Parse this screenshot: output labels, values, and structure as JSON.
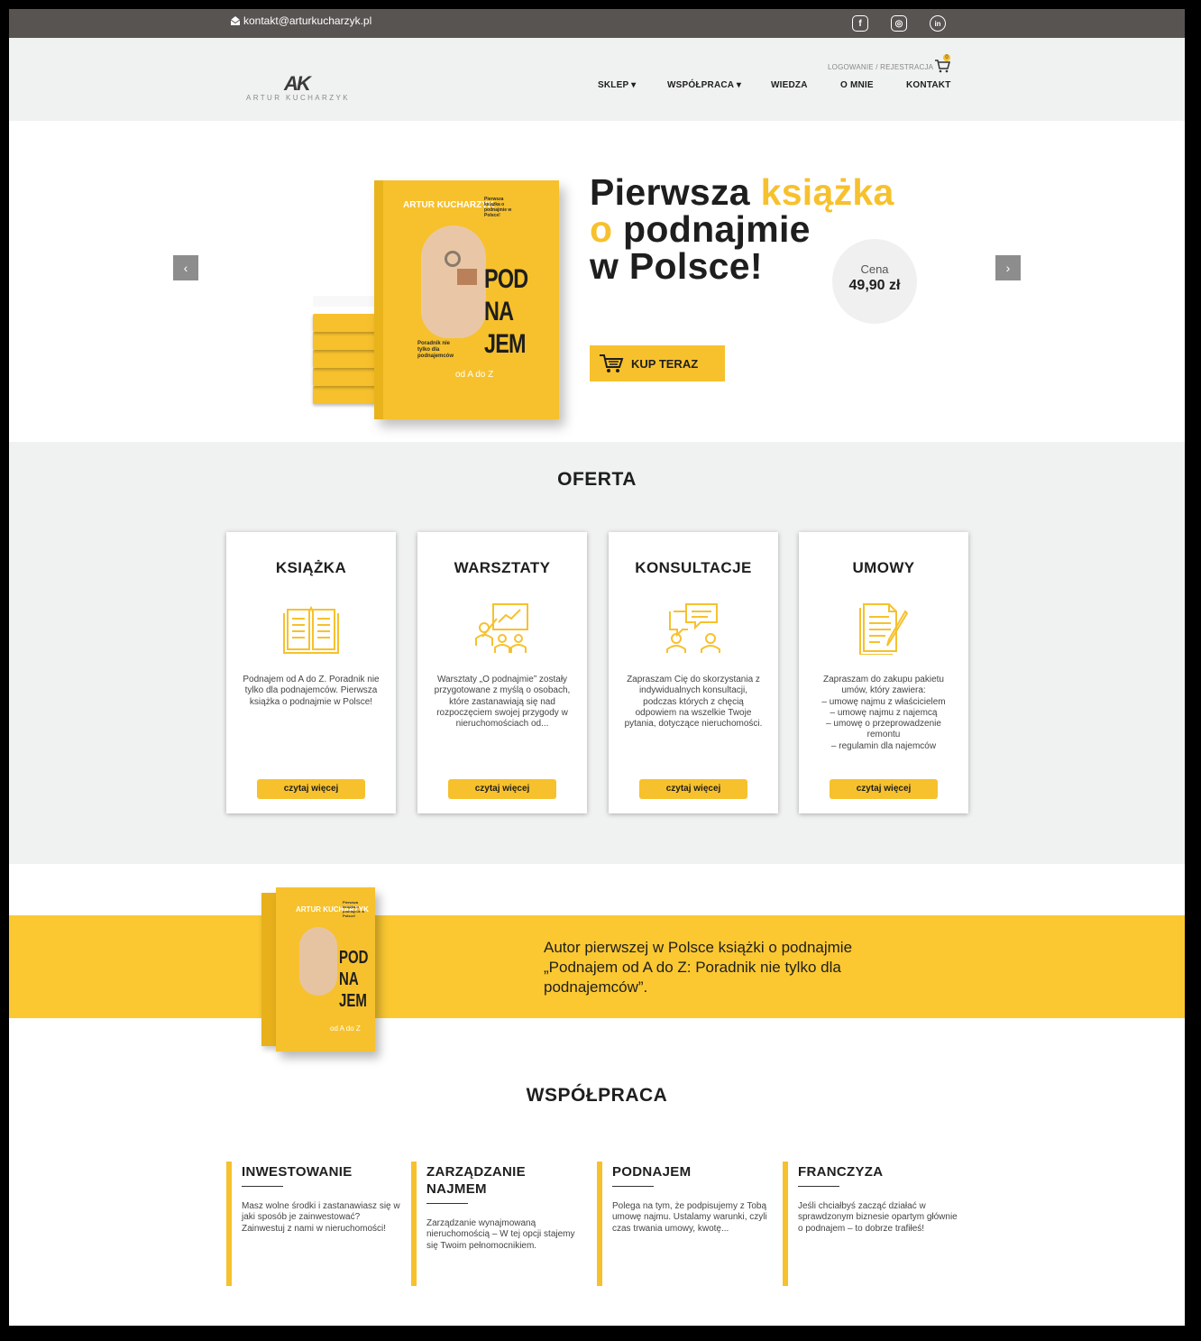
{
  "topbar": {
    "email": "kontakt@arturkucharzyk.pl",
    "social": [
      {
        "icon": "facebook-icon",
        "glyph": "f"
      },
      {
        "icon": "instagram-icon",
        "glyph": "◎"
      },
      {
        "icon": "linkedin-icon",
        "glyph": "in"
      }
    ]
  },
  "header": {
    "logo_mark": "AK",
    "logo_name": "ARTUR KUCHARZYK",
    "login": "LOGOWANIE / REJESTRACJA",
    "cart_count": "0",
    "nav": [
      "SKLEP ▾",
      "WSPÓŁPRACA ▾",
      "WIEDZA",
      "O MNIE",
      "KONTAKT"
    ]
  },
  "hero": {
    "title_1": "Pierwsza ",
    "title_1_accent": "książka",
    "title_2_accent": "o",
    "title_2": " podnajmie",
    "title_3": "w Polsce!",
    "price_label": "Cena",
    "price_value": "49,90 zł",
    "buy_label": "KUP TERAZ",
    "prev": "‹",
    "next": "›",
    "book": {
      "author": "ARTUR KUCHARZYK",
      "subtitle": "Pierwsza książka o podnajmie w Polsce!",
      "title": "POD NA JEM",
      "small": "Poradnik nie tylko dla podnajemców",
      "az": "od A do Z"
    }
  },
  "oferta": {
    "title": "OFERTA",
    "cards": [
      {
        "title": "KSIĄŻKA",
        "icon": "book-icon",
        "text": "Podnajem od A do Z. Poradnik nie tylko dla podnajemców. Pierwsza książka o podnajmie w Polsce!",
        "button": "czytaj więcej"
      },
      {
        "title": "WARSZTATY",
        "icon": "workshop-icon",
        "text": "Warsztaty „O podnajmie” zostały przygotowane z myślą o osobach, które zastanawiają się nad rozpoczęciem swojej przygody w nieruchomościach od...",
        "button": "czytaj więcej"
      },
      {
        "title": "KONSULTACJE",
        "icon": "consultation-icon",
        "text": "Zapraszam Cię do skorzystania z indywidualnych konsultacji, podczas których z chęcią odpowiem na wszelkie Twoje pytania, dotyczące nieruchomości.",
        "button": "czytaj więcej"
      },
      {
        "title": "UMOWY",
        "icon": "contract-icon",
        "text": "Zapraszam do zakupu pakietu umów, który zawiera:\n– umowę najmu z właścicielem\n– umowę najmu z najemcą\n– umowę o przeprowadzenie remontu\n– regulamin dla najemców",
        "button": "czytaj więcej"
      }
    ]
  },
  "author_band": {
    "text": "Autor pierwszej w Polsce książki o podnajmie „Podnajem od A do Z: Poradnik nie tylko dla podnajemców”."
  },
  "wspolpraca": {
    "title": "WSPÓŁPRACA",
    "columns": [
      {
        "title": "INWESTOWANIE",
        "text": "Masz wolne środki i zastanawiasz się w jaki sposób je zainwestować? Zainwestuj z nami w nieruchomości!"
      },
      {
        "title": "ZARZĄDZANIE NAJMEM",
        "text": "Zarządzanie wynajmowaną nieruchomością – W tej opcji stajemy się Twoim pełnomocnikiem."
      },
      {
        "title": "PODNAJEM",
        "text": "Polega na tym, że podpisujemy z Tobą umowę najmu. Ustalamy warunki, czyli czas trwania umowy, kwotę..."
      },
      {
        "title": "FRANCZYZA",
        "text": "Jeśli chciałbyś zacząć działać w sprawdzonym biznesie opartym głównie o podnajem – to dobrze trafiłeś!"
      }
    ]
  },
  "colors": {
    "accent": "#f7c12d",
    "band": "#fbc831",
    "topbar": "#575452",
    "header_bg": "#f0f1f1"
  }
}
